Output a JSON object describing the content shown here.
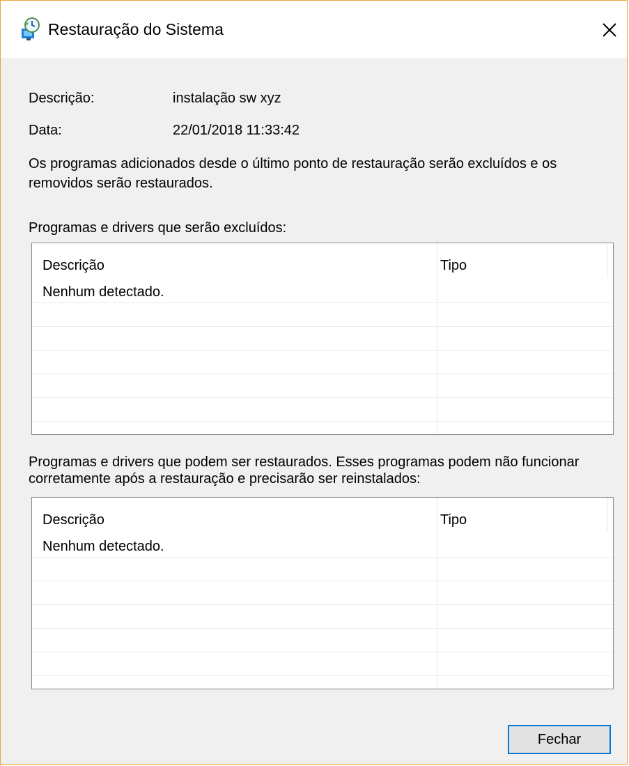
{
  "window": {
    "title": "Restauração do Sistema",
    "close_icon_name": "close-icon",
    "app_icon_name": "system-restore-icon",
    "accent_color": "#e8a63c"
  },
  "details": {
    "description_label": "Descrição:",
    "description_value": "instalação sw xyz",
    "date_label": "Data:",
    "date_value": "22/01/2018 11:33:42",
    "note": "Os programas adicionados desde o último ponto de restauração serão excluídos e os removidos serão restaurados."
  },
  "removed_section": {
    "heading": "Programas e drivers que serão excluídos:",
    "columns": [
      "Descrição",
      "Tipo"
    ],
    "rows": [
      [
        "Nenhum detectado.",
        ""
      ]
    ]
  },
  "restored_section": {
    "heading": "Programas e drivers que podem ser restaurados. Esses programas podem não funcionar corretamente após a restauração e precisarão ser reinstalados:",
    "columns": [
      "Descrição",
      "Tipo"
    ],
    "rows": [
      [
        "Nenhum detectado.",
        ""
      ]
    ]
  },
  "footer": {
    "close_button_label": "Fechar",
    "button_border_color": "#0078d7"
  }
}
